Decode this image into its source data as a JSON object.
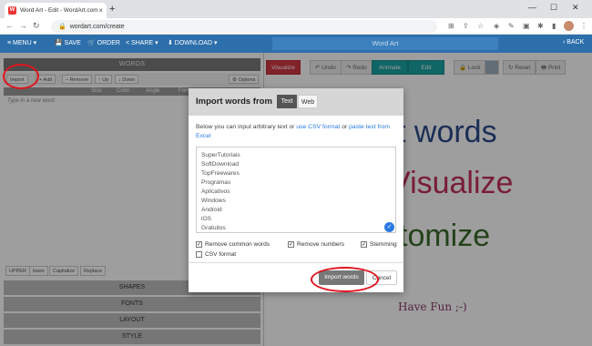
{
  "browser": {
    "tab_title": "Word Art - Edit - WordArt.com",
    "tab_icon": "W",
    "new_tab": "+",
    "close_tab": "×",
    "url": "wordart.com/create",
    "win_min": "—",
    "win_max": "☐",
    "win_close": "✕"
  },
  "toolbar": {
    "menu": "≡ MENU ▾",
    "save": "💾 SAVE",
    "order": "🛒 ORDER",
    "share": "< SHARE ▾",
    "download": "⬇ DOWNLOAD ▾",
    "title": "Word Art",
    "back": "‹ BACK"
  },
  "left": {
    "words_header": "WORDS",
    "buttons": [
      "Import",
      "+ Add",
      "– Remove",
      "↑ Up",
      "↓ Down",
      "⚙ Options"
    ],
    "columns": [
      "Size",
      "Color",
      "Angle",
      "Font"
    ],
    "new_word_placeholder": "Type in a new word",
    "case_buttons": [
      "UPPER",
      "lower",
      "Capitalize",
      "Replace"
    ],
    "sections": [
      "SHAPES",
      "FONTS",
      "LAYOUT",
      "STYLE"
    ]
  },
  "right": {
    "visualize": "Visualize",
    "undo": "↶ Undo",
    "redo": "↷ Redo",
    "animate": "Animate",
    "edit": "Edit",
    "lock": "🔒 Lock",
    "reset": "↻ Reset",
    "print": "🖶 Print",
    "canvas_words": [
      "t words",
      "Visualize",
      "tomize",
      "Have Fun ;-)"
    ]
  },
  "modal": {
    "title": "Import words from",
    "tab_text": "Text",
    "tab_web": "Web",
    "desc_prefix": "Below you can input arbitrary text or ",
    "desc_link1": "use CSV format",
    "desc_mid": " or ",
    "desc_link2": "paste text from Excel",
    "lines": [
      "SuperTutoriais",
      "SoftDownload",
      "TopFreewares",
      "Programas",
      "Aplicativos",
      "Windows",
      "Android",
      "iOS",
      "Gratuitos"
    ],
    "opt_remove_common": "Remove common words",
    "opt_remove_numbers": "Remove numbers",
    "opt_stemming": "Stemming",
    "opt_csv": "CSV format",
    "import_button": "Import words",
    "cancel_button": "Cancel"
  },
  "colors": {
    "brand_blue": "#2d6fab",
    "visualize_red": "#d23843",
    "animate_teal": "#1aa3a3",
    "word_blue": "#2b4b8c",
    "word_pink": "#c4305a",
    "word_green": "#3b6b2b",
    "annotation_red": "#e0141e"
  }
}
